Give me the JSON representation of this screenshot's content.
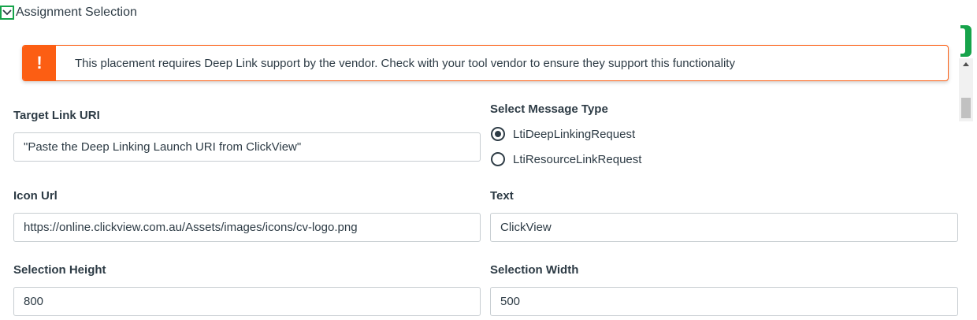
{
  "section": {
    "title": "Assignment Selection"
  },
  "alert": {
    "icon": "!",
    "message": "This placement requires Deep Link support by the vendor. Check with your tool vendor to ensure they support this functionality"
  },
  "form": {
    "target_link_uri": {
      "label": "Target Link URI",
      "value": "\"Paste the Deep Linking Launch URI from ClickView\""
    },
    "message_type": {
      "label": "Select Message Type",
      "options": [
        {
          "label": "LtiDeepLinkingRequest",
          "selected": true
        },
        {
          "label": "LtiResourceLinkRequest",
          "selected": false
        }
      ]
    },
    "icon_url": {
      "label": "Icon Url",
      "value": "https://online.clickview.com.au/Assets/images/icons/cv-logo.png"
    },
    "text": {
      "label": "Text",
      "value": "ClickView"
    },
    "selection_height": {
      "label": "Selection Height",
      "value": "800"
    },
    "selection_width": {
      "label": "Selection Width",
      "value": "500"
    }
  },
  "colors": {
    "alert_accent": "#fc5e13",
    "focus_green": "#16a34a",
    "text": "#2d3b45",
    "input_border": "#c7cdd1"
  }
}
